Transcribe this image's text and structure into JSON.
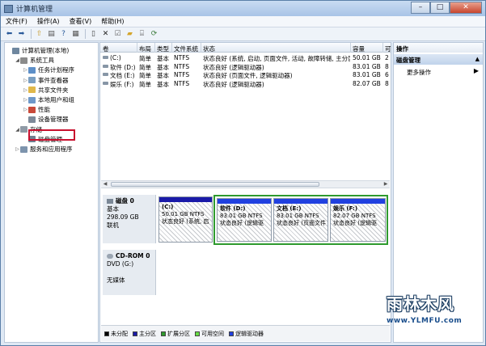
{
  "window": {
    "title": "计算机管理"
  },
  "menu": [
    "文件(F)",
    "操作(A)",
    "查看(V)",
    "帮助(H)"
  ],
  "toolbar": {
    "icons": [
      "back-icon",
      "forward-icon",
      "up-icon",
      "show-tree-icon",
      "help-icon",
      "view-icon",
      "connect-icon",
      "delete-icon",
      "properties-icon",
      "open-icon",
      "export-icon",
      "refresh-icon"
    ]
  },
  "tree": [
    {
      "label": "计算机管理(本地)",
      "indent": 0,
      "expander": "",
      "icon": "computer-icon",
      "color": "#6f879f"
    },
    {
      "label": "系统工具",
      "indent": 1,
      "expander": "◢",
      "icon": "tools-icon",
      "color": "#8b8b8b"
    },
    {
      "label": "任务计划程序",
      "indent": 2,
      "expander": "▷",
      "icon": "clock-icon",
      "color": "#5d8fc8"
    },
    {
      "label": "事件查看器",
      "indent": 2,
      "expander": "▷",
      "icon": "event-icon",
      "color": "#7a9fc2"
    },
    {
      "label": "共享文件夹",
      "indent": 2,
      "expander": "▷",
      "icon": "folder-icon",
      "color": "#e0b84a"
    },
    {
      "label": "本地用户和组",
      "indent": 2,
      "expander": "▷",
      "icon": "users-icon",
      "color": "#6e98c9"
    },
    {
      "label": "性能",
      "indent": 2,
      "expander": "▷",
      "icon": "performance-icon",
      "color": "#c94a3a"
    },
    {
      "label": "设备管理器",
      "indent": 2,
      "expander": "",
      "icon": "device-icon",
      "color": "#7d8a99"
    },
    {
      "label": "存储",
      "indent": 1,
      "expander": "◢",
      "icon": "storage-icon",
      "color": "#8f9aa6"
    },
    {
      "label": "磁盘管理",
      "indent": 2,
      "expander": "",
      "icon": "disk-icon",
      "color": "#6f7f90"
    },
    {
      "label": "服务和应用程序",
      "indent": 1,
      "expander": "▷",
      "icon": "services-icon",
      "color": "#7d94ad"
    }
  ],
  "volumes": {
    "columns": [
      "卷",
      "布局",
      "类型",
      "文件系统",
      "状态",
      "容量",
      "可"
    ],
    "rows": [
      [
        "(C:)",
        "简单",
        "基本",
        "NTFS",
        "状态良好 (系统, 启动, 页面文件, 活动, 故障转储, 主分区)",
        "50.01 GB",
        "2"
      ],
      [
        "软件 (D:)",
        "简单",
        "基本",
        "NTFS",
        "状态良好 (逻辑驱动器)",
        "83.01 GB",
        "8"
      ],
      [
        "文档 (E:)",
        "简单",
        "基本",
        "NTFS",
        "状态良好 (页面文件, 逻辑驱动器)",
        "83.01 GB",
        "6"
      ],
      [
        "娱乐 (F:)",
        "简单",
        "基本",
        "NTFS",
        "状态良好 (逻辑驱动器)",
        "82.07 GB",
        "8"
      ]
    ]
  },
  "disks": [
    {
      "name": "磁盘 0",
      "type": "基本",
      "size": "298.09 GB",
      "status": "联机",
      "partitions": [
        {
          "name": "(C:)",
          "size": "50.01 GB NTFS",
          "status": "状态良好 (系统, 启"
        },
        {
          "name": "软件  (D:)",
          "size": "83.01 GB NTFS",
          "status": "状态良好 (逻辑驱"
        },
        {
          "name": "文档  (E:)",
          "size": "83.01 GB NTFS",
          "status": "状态良好 (页面文件"
        },
        {
          "name": "娱乐  (F:)",
          "size": "82.07 GB NTFS",
          "status": "状态良好 (逻辑驱"
        }
      ]
    },
    {
      "name": "CD-ROM 0",
      "type": "DVD (G:)",
      "size": "",
      "status": "无媒体"
    }
  ],
  "legend": [
    {
      "label": "未分配",
      "color": "#000000"
    },
    {
      "label": "主分区",
      "color": "#1a1aa8"
    },
    {
      "label": "扩展分区",
      "color": "#2e9a2e"
    },
    {
      "label": "可用空间",
      "color": "#66dd44"
    },
    {
      "label": "逻辑驱动器",
      "color": "#2040e0"
    }
  ],
  "actions": {
    "header": "操作",
    "section": "磁盘管理",
    "more": "更多操作"
  },
  "watermark": {
    "main": "雨林木风",
    "url": "www.YLMFU.com"
  }
}
